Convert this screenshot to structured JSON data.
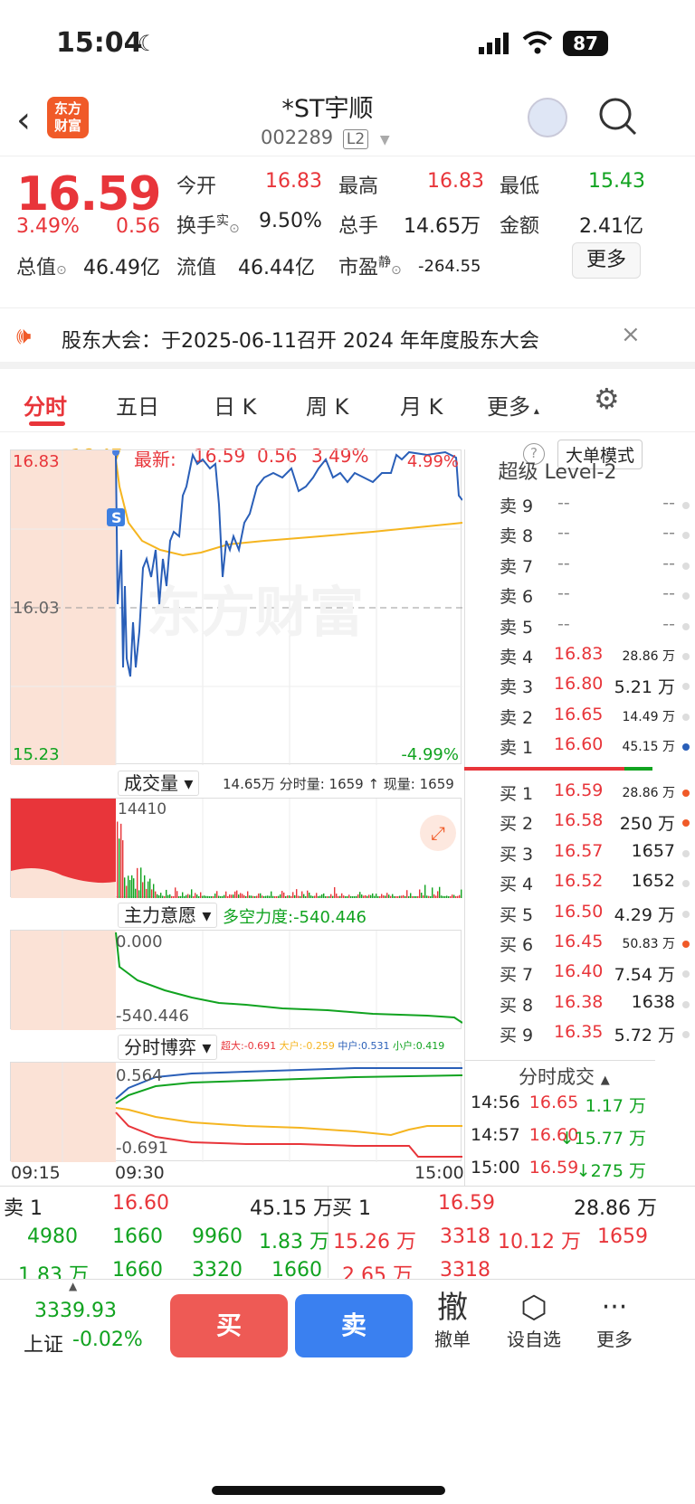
{
  "status": {
    "time": "15:04",
    "battery": "87"
  },
  "header": {
    "title": "*ST宇顺",
    "code": "002289",
    "level": "L2",
    "logo": "东方\n财富"
  },
  "quote": {
    "price": "16.59",
    "change_pct": "3.49%",
    "change": "0.56",
    "open_label": "今开",
    "open": "16.83",
    "high_label": "最高",
    "high": "16.83",
    "low_label": "最低",
    "low": "15.43",
    "turnover_label": "换手",
    "turnover_sup": "实",
    "turnover": "9.50%",
    "volume_label": "总手",
    "volume": "14.65万",
    "amount_label": "金额",
    "amount": "2.41亿",
    "mcap_label": "总值",
    "mcap": "46.49亿",
    "float_label": "流值",
    "float": "46.44亿",
    "pe_label": "市盈",
    "pe_sup": "静",
    "pe": "-264.55",
    "more": "更多"
  },
  "notice": {
    "text": "股东大会：于2025-06-11召开 2024 年年度股东大会"
  },
  "tabs": [
    "分时",
    "五日",
    "日 K",
    "周 K",
    "月 K",
    "更多"
  ],
  "info": {
    "avg_label": "均价:",
    "avg": "16.47",
    "latest_label": "最新:",
    "latest": "16.59",
    "chg": "0.56",
    "pct": "3.49%",
    "mode": "大单模式"
  },
  "chart": {
    "top": "16.83",
    "mid": "16.03",
    "bottom": "15.23",
    "top_pct": "4.99%",
    "bottom_pct": "-4.99%",
    "s_marker": "S",
    "vol_sel": "成交量",
    "vol_info": "14.65万 分时量: 1659 ↑ 现量: 1659",
    "vol_max": "14410",
    "main_sel": "主力意愿",
    "main_info": "多空力度:-540.446",
    "main_top": "0.000",
    "main_bottom": "-540.446",
    "game_sel": "分时博弈",
    "game_labels": [
      "超大:-0.691",
      "大户:-0.259",
      "中户:0.531",
      "小户:0.419"
    ],
    "game_top": "0.564",
    "game_bottom": "-0.691",
    "t_start": "09:15",
    "t_open": "09:30",
    "t_end": "15:00",
    "watermark": "东方财富"
  },
  "colors": {
    "red": "#e8353a",
    "green": "#11a320",
    "blue": "#2a5fb8",
    "yellow": "#f5b520"
  },
  "orderbook": {
    "title": "超级 Level-2",
    "asks": [
      {
        "n": "卖 9",
        "p": "--",
        "v": "--"
      },
      {
        "n": "卖 8",
        "p": "--",
        "v": "--"
      },
      {
        "n": "卖 7",
        "p": "--",
        "v": "--"
      },
      {
        "n": "卖 6",
        "p": "--",
        "v": "--"
      },
      {
        "n": "卖 5",
        "p": "--",
        "v": "--"
      },
      {
        "n": "卖 4",
        "p": "16.83",
        "v": "28.86 万"
      },
      {
        "n": "卖 3",
        "p": "16.80",
        "v": "5.21 万"
      },
      {
        "n": "卖 2",
        "p": "16.65",
        "v": "14.49 万"
      },
      {
        "n": "卖 1",
        "p": "16.60",
        "v": "45.15 万"
      }
    ],
    "bids": [
      {
        "n": "买 1",
        "p": "16.59",
        "v": "28.86 万"
      },
      {
        "n": "买 2",
        "p": "16.58",
        "v": "250 万"
      },
      {
        "n": "买 3",
        "p": "16.57",
        "v": "1657"
      },
      {
        "n": "买 4",
        "p": "16.52",
        "v": "1652"
      },
      {
        "n": "买 5",
        "p": "16.50",
        "v": "4.29 万"
      },
      {
        "n": "买 6",
        "p": "16.45",
        "v": "50.83 万"
      },
      {
        "n": "买 7",
        "p": "16.40",
        "v": "7.54 万"
      },
      {
        "n": "买 8",
        "p": "16.38",
        "v": "1638"
      },
      {
        "n": "买 9",
        "p": "16.35",
        "v": "5.72 万"
      }
    ],
    "trades_title": "分时成交",
    "trades": [
      {
        "t": "14:56",
        "p": "16.65",
        "v": "1.17 万"
      },
      {
        "t": "14:57",
        "p": "16.60",
        "v": "↓15.77 万"
      },
      {
        "t": "15:00",
        "p": "16.59",
        "v": "↓275 万"
      }
    ]
  },
  "queue": {
    "sell_label": "卖 1",
    "sell_price": "16.60",
    "sell_total": "45.15 万",
    "buy_label": "买 1",
    "buy_price": "16.59",
    "buy_total": "28.86 万",
    "sell_r1": [
      "4980",
      "1660",
      "9960",
      "1.83 万"
    ],
    "sell_r2": [
      "1.83 万",
      "1660",
      "3320",
      "1660"
    ],
    "buy_r1": [
      "15.26 万",
      "3318",
      "10.12 万",
      "1659"
    ],
    "buy_r2": [
      "2.65 万",
      "3318"
    ]
  },
  "bottom": {
    "index": "3339.93",
    "index_name": "上证",
    "index_chg": "-0.02%",
    "buy": "买",
    "sell": "卖",
    "cancel_icon": "撤",
    "cancel": "撤单",
    "watch": "设自选",
    "more": "更多"
  }
}
